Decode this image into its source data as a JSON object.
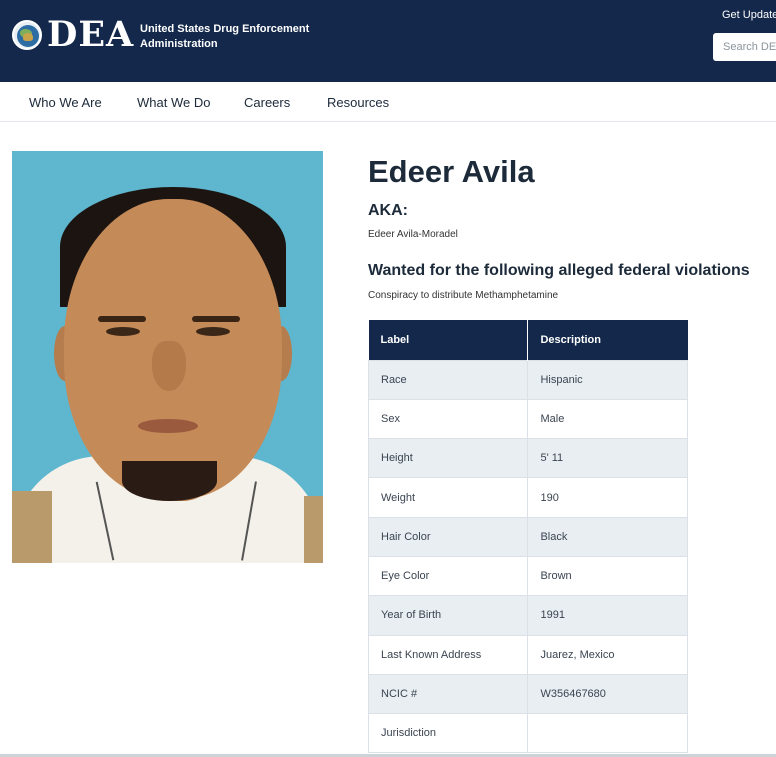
{
  "header": {
    "logo_text": "DEA",
    "agency_name": "United States Drug Enforcement Administration",
    "get_updates": "Get Updates",
    "search_placeholder": "Search DEA"
  },
  "nav": {
    "items": [
      "Who We Are",
      "What We Do",
      "Careers",
      "Resources"
    ]
  },
  "profile": {
    "name": "Edeer Avila",
    "aka_label": "AKA:",
    "aka_value": "Edeer Avila-Moradel",
    "wanted_heading": "Wanted for the following alleged federal violations",
    "violation": "Conspiracy to distribute Methamphetamine"
  },
  "details_table": {
    "headers": [
      "Label",
      "Description"
    ],
    "rows": [
      {
        "label": "Race",
        "value": "Hispanic"
      },
      {
        "label": "Sex",
        "value": "Male"
      },
      {
        "label": "Height",
        "value": "5' 11"
      },
      {
        "label": "Weight",
        "value": "190"
      },
      {
        "label": "Hair Color",
        "value": "Black"
      },
      {
        "label": "Eye Color",
        "value": "Brown"
      },
      {
        "label": "Year of Birth",
        "value": "1991"
      },
      {
        "label": "Last Known Address",
        "value": "Juarez, Mexico"
      },
      {
        "label": "NCIC #",
        "value": "W356467680"
      },
      {
        "label": "Jurisdiction",
        "value": ""
      }
    ]
  },
  "colors": {
    "header_bg": "#13284a",
    "table_alt_row": "#e9eef3",
    "photo_bg": "#5fb7cf"
  }
}
